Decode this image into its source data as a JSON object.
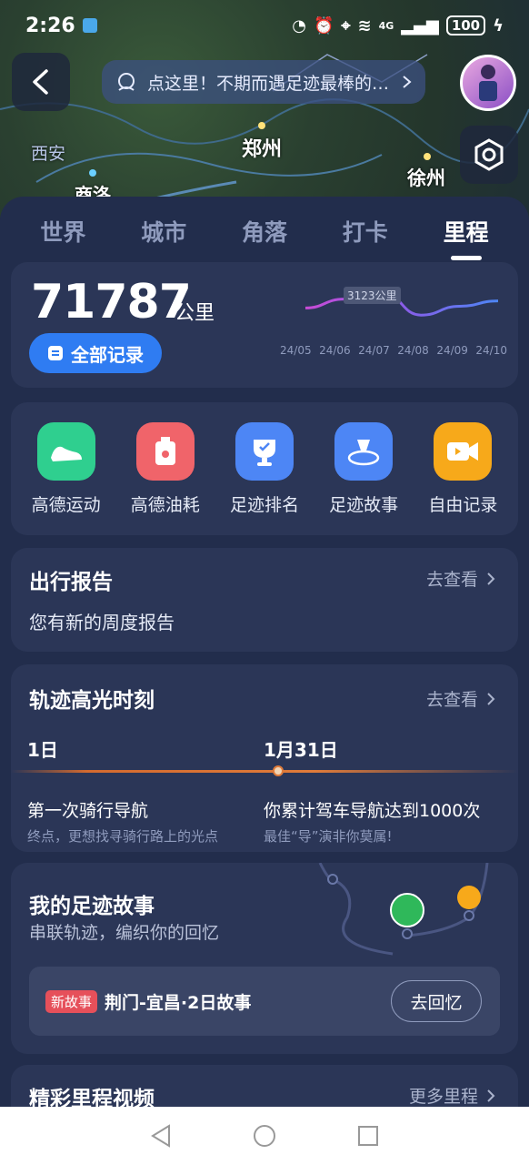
{
  "status": {
    "time": "2:26",
    "battery": "100",
    "network": "4G"
  },
  "map": {
    "cities": [
      "西安",
      "郑州",
      "商洛",
      "徐州"
    ]
  },
  "banner": {
    "text": "点这里！不期而遇足迹最棒的…"
  },
  "tabs": [
    {
      "label": "世界",
      "active": false
    },
    {
      "label": "城市",
      "active": false
    },
    {
      "label": "角落",
      "active": false
    },
    {
      "label": "打卡",
      "active": false
    },
    {
      "label": "里程",
      "active": true
    }
  ],
  "mileage": {
    "total": "71787",
    "unit": "公里",
    "all_records_label": "全部记录",
    "peak_label": "3123公里"
  },
  "chart_data": {
    "type": "line",
    "x": [
      "24/05",
      "24/06",
      "24/07",
      "24/08",
      "24/09",
      "24/10"
    ],
    "values": [
      2700,
      2950,
      3123,
      2500,
      2750,
      2900
    ]
  },
  "tools": [
    {
      "label": "高德运动",
      "icon": "shoe-icon",
      "color": "#2fcf8f"
    },
    {
      "label": "高德油耗",
      "icon": "fuel-icon",
      "color": "#f0646a"
    },
    {
      "label": "足迹排名",
      "icon": "trophy-icon",
      "color": "#4d86f5"
    },
    {
      "label": "足迹故事",
      "icon": "footprint-story-icon",
      "color": "#4d86f5"
    },
    {
      "label": "自由记录",
      "icon": "video-record-icon",
      "color": "#f7a91a"
    }
  ],
  "report": {
    "title": "出行报告",
    "link": "去查看",
    "subtitle": "您有新的周度报告"
  },
  "highlight": {
    "title": "轨迹高光时刻",
    "link": "去查看",
    "events": [
      {
        "date": "1日",
        "event": "第一次骑行导航",
        "desc": "终点，更想找寻骑行路上的光点"
      },
      {
        "date": "1月31日",
        "event": "你累计驾车导航达到1000次",
        "desc": "最佳“导”演非你莫属!"
      }
    ]
  },
  "story": {
    "title": "我的足迹故事",
    "subtitle": "串联轨迹，编织你的回忆",
    "tag": "新故事",
    "name": "荆门-宜昌·2日故事",
    "button": "去回忆"
  },
  "video": {
    "title": "精彩里程视频",
    "link": "更多里程"
  }
}
